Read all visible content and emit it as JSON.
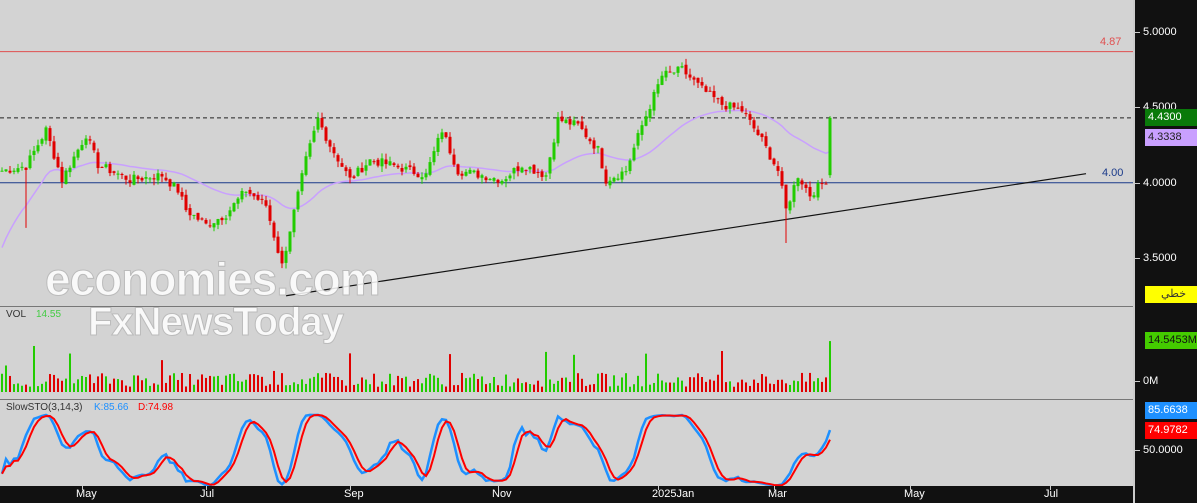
{
  "chart_data": {
    "type": "candlestick",
    "price_axis": {
      "ticks": [
        "5.0000",
        "4.5000",
        "4.0000",
        "3.5000"
      ],
      "range": [
        3.1,
        5.2
      ]
    },
    "x_labels": [
      {
        "label": "May",
        "day": 20
      },
      {
        "label": "Jul",
        "day": 51
      },
      {
        "label": "Sep",
        "day": 87
      },
      {
        "label": "Nov",
        "day": 124
      },
      {
        "label": "2025Jan",
        "day": 164
      },
      {
        "label": "Mar",
        "day": 193
      },
      {
        "label": "May",
        "day": 227
      },
      {
        "label": "Jul",
        "day": 262
      }
    ],
    "price_path": [
      [
        0,
        4.08
      ],
      [
        6,
        4.11
      ],
      [
        11,
        4.35
      ],
      [
        15,
        4.02
      ],
      [
        21,
        4.32
      ],
      [
        24,
        4.12
      ],
      [
        32,
        4.02
      ],
      [
        40,
        4.05
      ],
      [
        44,
        3.95
      ],
      [
        46,
        3.82
      ],
      [
        51,
        3.72
      ],
      [
        56,
        3.79
      ],
      [
        61,
        3.95
      ],
      [
        66,
        3.85
      ],
      [
        70,
        3.45
      ],
      [
        72,
        3.69
      ],
      [
        76,
        4.15
      ],
      [
        79,
        4.42
      ],
      [
        82,
        4.25
      ],
      [
        87,
        4.02
      ],
      [
        92,
        4.15
      ],
      [
        97,
        4.12
      ],
      [
        102,
        4.08
      ],
      [
        106,
        4.05
      ],
      [
        110,
        4.35
      ],
      [
        114,
        4.08
      ],
      [
        120,
        4.05
      ],
      [
        125,
        4.02
      ],
      [
        130,
        4.12
      ],
      [
        136,
        4.05
      ],
      [
        139,
        4.42
      ],
      [
        144,
        4.38
      ],
      [
        149,
        4.22
      ],
      [
        151,
        4.02
      ],
      [
        156,
        4.08
      ],
      [
        160,
        4.38
      ],
      [
        165,
        4.71
      ],
      [
        170,
        4.75
      ],
      [
        175,
        4.62
      ],
      [
        180,
        4.52
      ],
      [
        185,
        4.48
      ],
      [
        190,
        4.28
      ],
      [
        194,
        4.08
      ],
      [
        196,
        3.82
      ],
      [
        199,
        4.05
      ],
      [
        202,
        3.92
      ],
      [
        206,
        4.02
      ],
      [
        207,
        4.43
      ]
    ],
    "horizontal_lines": [
      {
        "value": 4.87,
        "label": "4.87",
        "color": "#e05050"
      },
      {
        "value": 4.43,
        "style": "dashed"
      },
      {
        "value": 4.0,
        "label": "4.00",
        "color": "#1a3a8a"
      }
    ],
    "trendline": [
      [
        71,
        3.25
      ],
      [
        271,
        4.06
      ]
    ],
    "last_price": "4.4300",
    "ma_value": "4.3338",
    "chart_type_label": "خطي",
    "volume": {
      "label": "VOL",
      "value": "14.55",
      "last_tag": "14.5453M",
      "zero_tag": "0M",
      "last": 14.55
    },
    "stochastic": {
      "label": "SlowSTO(3,14,3)",
      "k_label": "K:85.66",
      "d_label": "D:74.98",
      "k_tag": "85.6638",
      "d_tag": "74.9782",
      "tick": "50.0000"
    },
    "colors": {
      "up": "#22cc00",
      "down": "#e00000",
      "ma": "#c9a0ff",
      "k": "#1e90ff",
      "d": "#ff0000"
    }
  },
  "watermarks": [
    "economies.com",
    "FxNewsToday"
  ]
}
